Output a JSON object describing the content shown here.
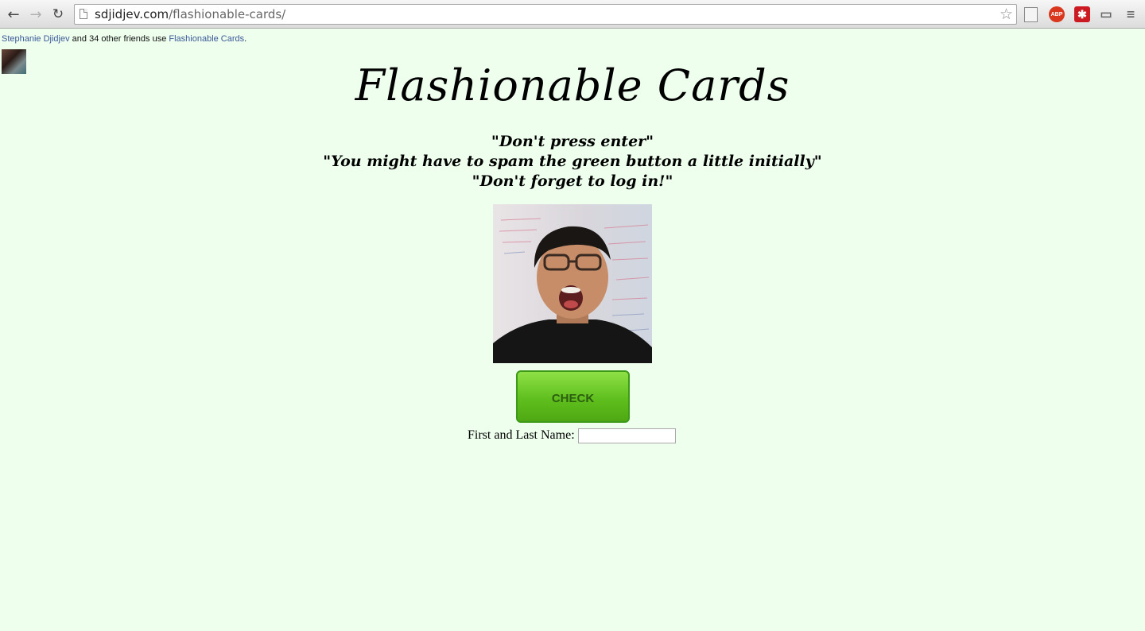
{
  "browser": {
    "url_host": "sdjidjev.com",
    "url_path": "/flashionable-cards/",
    "abp_label": "ABP",
    "lastpass_label": "✱"
  },
  "social": {
    "friend_name": "Stephanie Djidjev",
    "middle_text": " and 34 other friends use ",
    "app_name": "Flashionable Cards",
    "end_text": "."
  },
  "page": {
    "title": "Flashionable Cards",
    "quotes": [
      "\"Don't press enter\"",
      "\"You might have to spam the green button a little initially\"",
      "\"Don't forget to log in!\""
    ],
    "check_label": "CHECK",
    "name_label": "First and Last Name:",
    "name_value": ""
  },
  "colors": {
    "page_background": "#eeffee",
    "button_green": "#5fbf1d",
    "link_blue": "#3b5998"
  }
}
